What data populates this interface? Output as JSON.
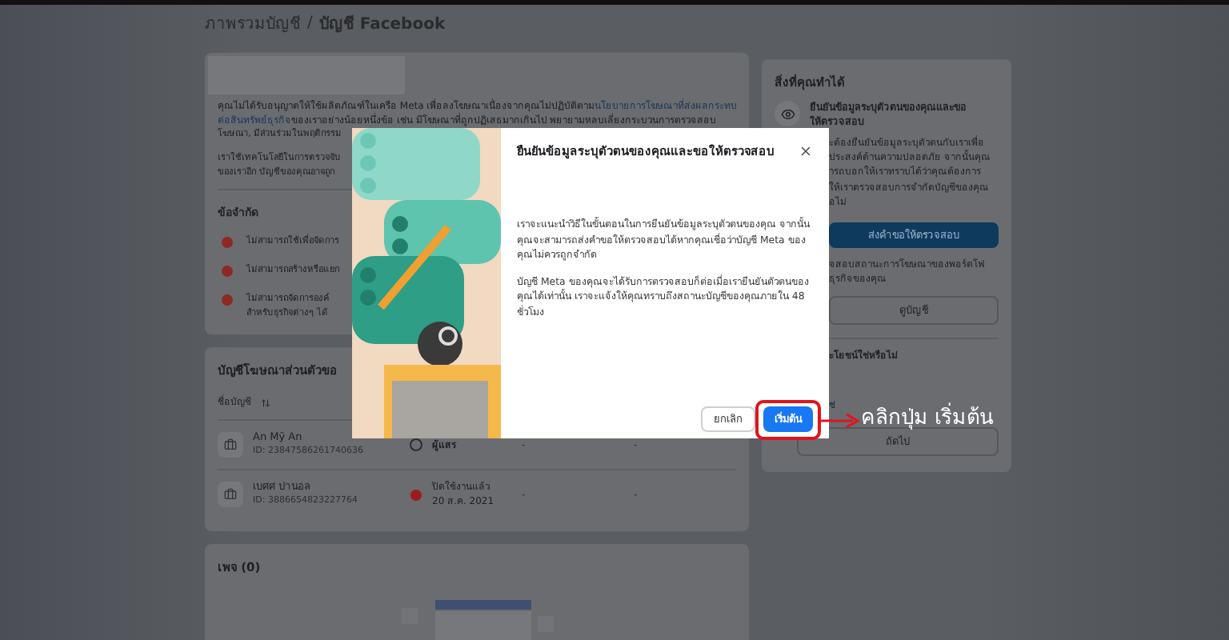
{
  "breadcrumb": {
    "items": [
      "ภาพรวมบัญชี",
      "บัญชี Facebook"
    ],
    "separator": "/"
  },
  "restriction_card": {
    "notice_lines": [
      {
        "segments": [
          {
            "kind": "text",
            "text": "คุณไม่ได้รับอนุญาตให้ใช้ผลิตภัณฑ์ในเครือ Meta เพื่อลงโฆษณาเนื่องจากคุณไม่ปฏิบัติตาม"
          },
          {
            "kind": "link",
            "text": "นโยบายการโฆษณาที่ส่งผลกระทบ"
          }
        ]
      },
      {
        "segments": [
          {
            "kind": "link",
            "text": "ต่อสินทรัพย์ธุรกิจ"
          },
          {
            "kind": "text",
            "text": "ของเราอย่างน้อยหนึ่งข้อ เช่น มีโฆษณาที่ถูกปฏิเสธมากเกินไป พยายามหลบเลี่ยงกระบวนการตรวจสอบ"
          }
        ]
      },
      {
        "segments": [
          {
            "kind": "text",
            "text": "โฆษณา, มีส่วนร่วมในพฤติกรรม"
          }
        ]
      }
    ],
    "detection_lines": [
      "เราใช้เทคโนโลยีในการตรวจจับ",
      "ของเราอีก บัญชีของคุณอาจถูก"
    ],
    "limits_title": "ข้อจำกัด",
    "limits": [
      {
        "lines": [
          "ไม่สามารถใช้เพื่อจัดการ"
        ]
      },
      {
        "lines": [
          "ไม่สามารถสร้างหรือแยก"
        ]
      },
      {
        "lines": [
          "ไม่สามารถจัดการองค์",
          "สำหรับธุรกิจต่างๆ ได้"
        ]
      }
    ]
  },
  "ad_accounts_card": {
    "title": "บัญชีโฆษณาส่วนตัวขอ",
    "column_header": "ชื่อบัญชี",
    "rows": [
      {
        "name": "An Mỹ An",
        "id": "ID: 23847586261740636",
        "kind": "pending",
        "status_lines": [
          "ผู้แสร"
        ],
        "column_3": "-",
        "column_4": "-"
      },
      {
        "name": "เบศศ ปานอล",
        "id": "ID: 3886654823227764",
        "kind": "disabled",
        "status_lines": [
          "ปิดใช้งานแล้ว",
          "20 ส.ค. 2021"
        ],
        "column_3": "-",
        "column_4": "-"
      }
    ]
  },
  "pages_card": {
    "title": "เพจ (0)"
  },
  "actions_card": {
    "title": "สิ่งที่คุณทำได้",
    "item_title_lines": [
      "ยืนยันข้อมูลระบุตัวตนของคุณและขอ",
      "ให้ตรวจสอบ"
    ],
    "item_lines": [
      "ะต้องยืนยันข้อมูลระบุตัวตนกับเราเพื่อ",
      "ประสงค์ด้านความปลอดภัย จากนั้นคุณ",
      "ารถบอกให้เราทราบได้ว่าคุณต้องการ",
      "ให้เราตรวจสอบการจำกัดบัญชีของคุณ",
      "อไม่"
    ],
    "primary_button": "ส่งคำขอให้ตรวจสอบ",
    "status_lines": [
      "จสอบสถานะการโฆษณาของพอร์ตโฟ",
      "ธุรกิจของคุณ"
    ],
    "view_button": "ดูบัญชี",
    "feedback_question": "ะโยชน์ใช่หรือไม่",
    "feedback_option": "ช่",
    "next_button": "ถัดไป"
  },
  "dialog": {
    "title": "ยืนยันข้อมูลระบุตัวตนของคุณและขอให้ตรวจสอบ",
    "paragraphs": [
      "เราจะแนะนำวิธีในขั้นตอนในการยืนยันข้อมูลระบุตัวตนของคุณ จากนั้นคุณจะสามารถส่งคำขอให้ตรวจสอบได้หากคุณเชื่อว่าบัญชี Meta ของคุณไม่ควรถูกจำกัด",
      "บัญชี Meta ของคุณจะได้รับการตรวจสอบก็ต่อเมื่อเรายืนยันตัวตนของคุณได้เท่านั้น เราจะแจ้งให้คุณทราบถึงสถานะบัญชีของคุณภายใน 48 ชั่วโมง"
    ],
    "cancel_button": "ยกเลิก",
    "start_button": "เริ่มต้น"
  },
  "annotation": {
    "text": "คลิกปุ่ม เริ่มต้น"
  }
}
